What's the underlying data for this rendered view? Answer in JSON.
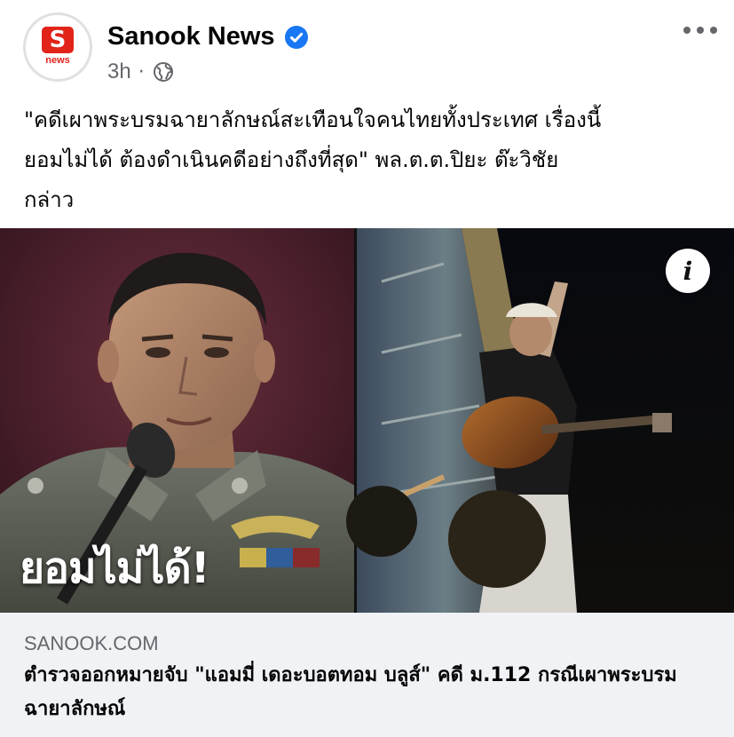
{
  "post": {
    "page_name": "Sanook News",
    "verified_icon": "verified-badge-icon",
    "timestamp": "3h",
    "separator": "·",
    "audience_icon": "globe-icon",
    "more_icon": "more-options-icon",
    "avatar_logo_letter": "S",
    "avatar_logo_text": "news",
    "text": "\"คดีเผาพระบรมฉายาลักษณ์สะเทือนใจคนไทยทั้งประเทศ เรื่องนี้\nยอมไม่ได้ ต้องดำเนินคดีอย่างถึงที่สุด\" พล.ต.ต.ปิยะ ต๊ะวิชัย\nกล่าว"
  },
  "media": {
    "overlay_caption": "ยอมไม่ได้!",
    "info_icon": "info-icon",
    "info_label": "i"
  },
  "link_preview": {
    "domain": "SANOOK.COM",
    "title": "ตำรวจออกหมายจับ \"แอมมี่ เดอะบอตทอม บลูส์\" คดี ม.112 กรณีเผาพระบรมฉายาลักษณ์"
  },
  "colors": {
    "verified_blue": "#1877f2",
    "brand_red": "#e2231a",
    "secondary_text": "#65676b",
    "link_bg": "#f0f2f5"
  }
}
